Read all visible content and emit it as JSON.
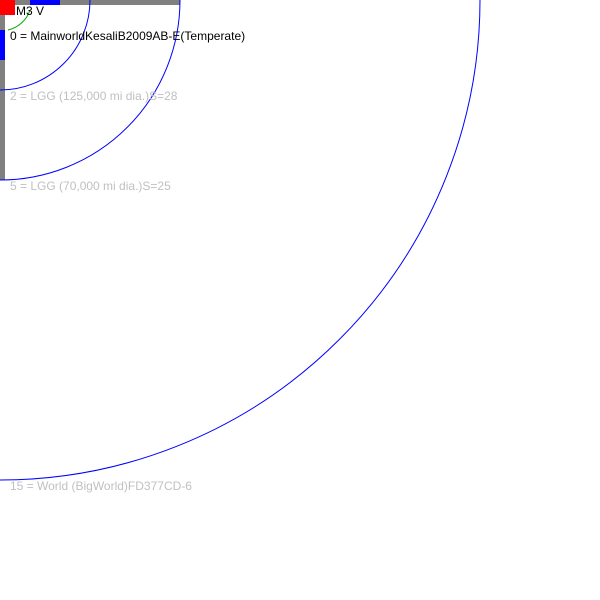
{
  "star": {
    "label": "M3 V",
    "color": "#ff0000"
  },
  "colors": {
    "orbit": "#0000ff",
    "frame": "#808080",
    "zone_marker": "#0000ff",
    "habitable_arc": "#00aa00",
    "muted_label": "#c0c0c0",
    "primary_label": "#000000"
  },
  "orbits": [
    {
      "orbit": 0,
      "label": "0 = MainworldKesaliB2009AB-E(Temperate)"
    },
    {
      "orbit": 2,
      "label": "2 = LGG (125,000 mi dia.)S=28"
    },
    {
      "orbit": 5,
      "label": "5 = LGG (70,000 mi dia.)S=25"
    },
    {
      "orbit": 15,
      "label": "15 = World  (BigWorld)FD377CD-6"
    }
  ]
}
